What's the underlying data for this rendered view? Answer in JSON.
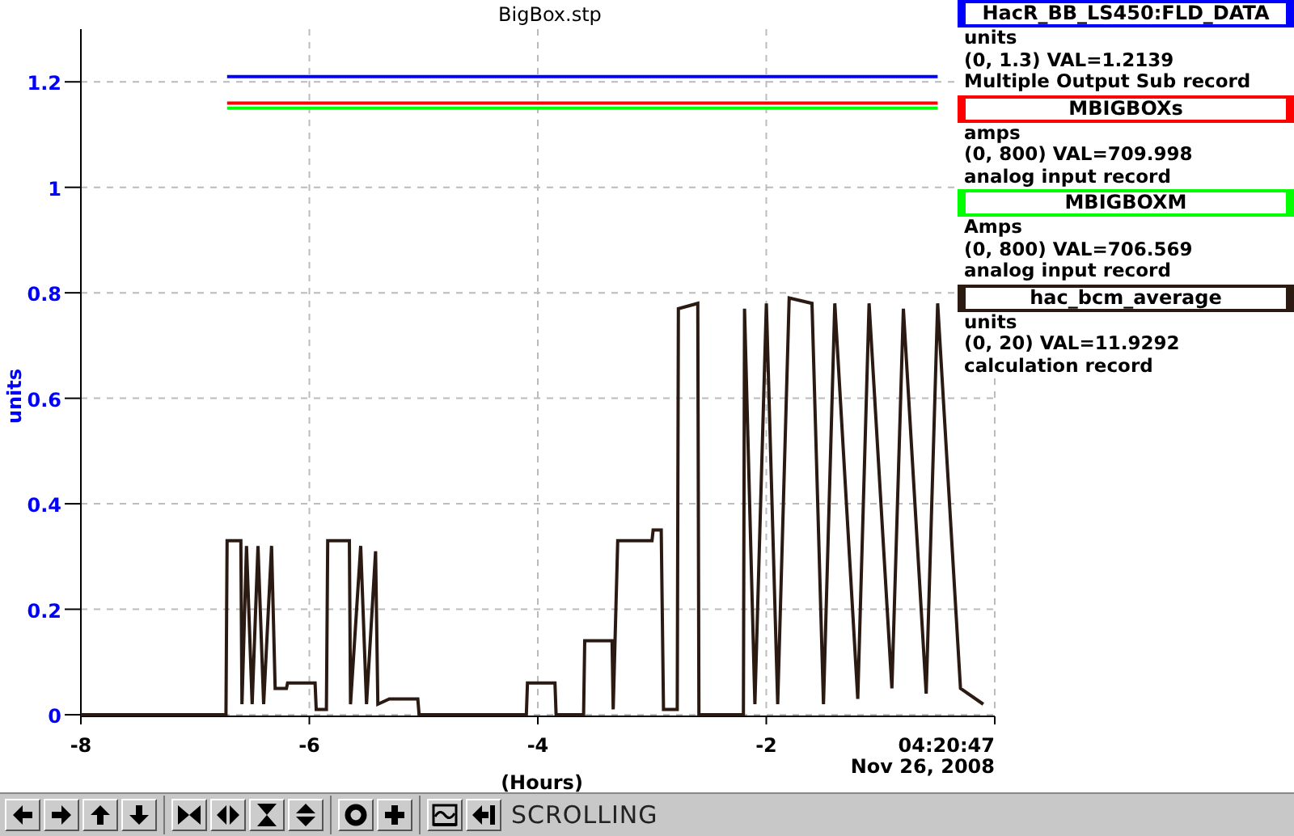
{
  "plot": {
    "chart_data": {
      "type": "line",
      "title": "BigBox.stp",
      "xlabel": "(Hours)",
      "ylabel": "units",
      "xlim": [
        -8,
        0
      ],
      "ylim": [
        0,
        1.3
      ],
      "xticks": [
        -8,
        -6,
        -4,
        -2
      ],
      "yticks": [
        0,
        0.2,
        0.4,
        0.6,
        0.8,
        1,
        1.2
      ],
      "grid": true,
      "x": [
        -8,
        -6.73,
        -6.72,
        -6.6,
        -6.59,
        -6.55,
        -6.5,
        -6.45,
        -6.4,
        -6.33,
        -6.3,
        -6.2,
        -6.19,
        -5.95,
        -5.94,
        -5.85,
        -5.84,
        -5.65,
        -5.64,
        -5.55,
        -5.5,
        -5.42,
        -5.4,
        -5.3,
        -5.05,
        -5.04,
        -4.1,
        -4.09,
        -3.85,
        -3.84,
        -3.6,
        -3.59,
        -3.35,
        -3.34,
        -3.3,
        -3.0,
        -2.99,
        -2.92,
        -2.9,
        -2.78,
        -2.77,
        -2.6,
        -2.59,
        -2.2,
        -2.19,
        -2.1,
        -2.0,
        -1.9,
        -1.8,
        -1.6,
        -1.5,
        -1.4,
        -1.2,
        -1.1,
        -0.9,
        -0.8,
        -0.6,
        -0.5,
        -0.3,
        -0.1
      ],
      "series": [
        {
          "name": "HacR_BB_LS450:FLD_DATA",
          "color": "#0000ff",
          "values": [
            null,
            null,
            1.21,
            1.21,
            1.21,
            1.21,
            1.21,
            1.21,
            1.21,
            1.21,
            1.21,
            1.21,
            1.21,
            1.21,
            1.21,
            1.21,
            1.21,
            1.21,
            1.21,
            1.21,
            1.21,
            1.21,
            1.21,
            1.21,
            1.21,
            1.21,
            1.21,
            1.21,
            1.21,
            1.21,
            1.21,
            1.21,
            1.21,
            1.21,
            1.21,
            1.21,
            1.21,
            1.21,
            1.21,
            1.21,
            1.21,
            1.21,
            1.21,
            1.21,
            1.21,
            1.21,
            1.21,
            1.21,
            1.21,
            1.21,
            1.21,
            1.21,
            1.21,
            1.21,
            1.21,
            1.21,
            1.21,
            1.21,
            null,
            null
          ]
        },
        {
          "name": "MBIGBOXs",
          "color": "#ff0000",
          "values": [
            null,
            null,
            1.16,
            1.16,
            1.16,
            1.16,
            1.16,
            1.16,
            1.16,
            1.16,
            1.16,
            1.16,
            1.16,
            1.16,
            1.16,
            1.16,
            1.16,
            1.16,
            1.16,
            1.16,
            1.16,
            1.16,
            1.16,
            1.16,
            1.16,
            1.16,
            1.16,
            1.16,
            1.16,
            1.16,
            1.16,
            1.16,
            1.16,
            1.16,
            1.16,
            1.16,
            1.16,
            1.16,
            1.16,
            1.16,
            1.16,
            1.16,
            1.16,
            1.16,
            1.16,
            1.16,
            1.16,
            1.16,
            1.16,
            1.16,
            1.16,
            1.16,
            1.16,
            1.16,
            1.16,
            1.16,
            1.16,
            1.16,
            null,
            null
          ]
        },
        {
          "name": "MBIGBOXM",
          "color": "#00ff00",
          "values": [
            null,
            null,
            1.15,
            1.15,
            1.15,
            1.15,
            1.15,
            1.15,
            1.15,
            1.15,
            1.15,
            1.15,
            1.15,
            1.15,
            1.15,
            1.15,
            1.15,
            1.15,
            1.15,
            1.15,
            1.15,
            1.15,
            1.15,
            1.15,
            1.15,
            1.15,
            1.15,
            1.15,
            1.15,
            1.15,
            1.15,
            1.15,
            1.15,
            1.15,
            1.15,
            1.15,
            1.15,
            1.15,
            1.15,
            1.15,
            1.15,
            1.15,
            1.15,
            1.15,
            1.15,
            1.15,
            1.15,
            1.15,
            1.15,
            1.15,
            1.15,
            1.15,
            1.15,
            1.15,
            1.15,
            1.15,
            1.15,
            1.15,
            null,
            null
          ]
        },
        {
          "name": "hac_bcm_average",
          "color": "#2a1a12",
          "values": [
            0,
            0,
            0.33,
            0.33,
            0.02,
            0.32,
            0.02,
            0.32,
            0.02,
            0.32,
            0.05,
            0.05,
            0.06,
            0.06,
            0.01,
            0.01,
            0.33,
            0.33,
            0.02,
            0.32,
            0.02,
            0.31,
            0.02,
            0.03,
            0.03,
            0.0,
            0.0,
            0.06,
            0.06,
            0.0,
            0.0,
            0.14,
            0.14,
            0.01,
            0.33,
            0.33,
            0.35,
            0.35,
            0.01,
            0.01,
            0.77,
            0.78,
            0.0,
            0.0,
            0.77,
            0.02,
            0.78,
            0.02,
            0.79,
            0.78,
            0.02,
            0.78,
            0.03,
            0.78,
            0.05,
            0.77,
            0.04,
            0.78,
            0.05,
            0.02
          ]
        }
      ]
    },
    "time": "04:20:47",
    "date": "Nov 26, 2008"
  },
  "legend": [
    {
      "units": "units",
      "range_value": "(0, 1.3) VAL=1.2139",
      "record_type": "Multiple Output Sub record"
    },
    {
      "units": "amps",
      "range_value": "(0, 800) VAL=709.998",
      "record_type": "analog input record"
    },
    {
      "units": "Amps",
      "range_value": "(0, 800) VAL=706.569",
      "record_type": "analog input record"
    },
    {
      "units": "units",
      "range_value": "(0, 20) VAL=11.9292",
      "record_type": "calculation record"
    }
  ],
  "toolbar": {
    "status": "SCROLLING"
  }
}
